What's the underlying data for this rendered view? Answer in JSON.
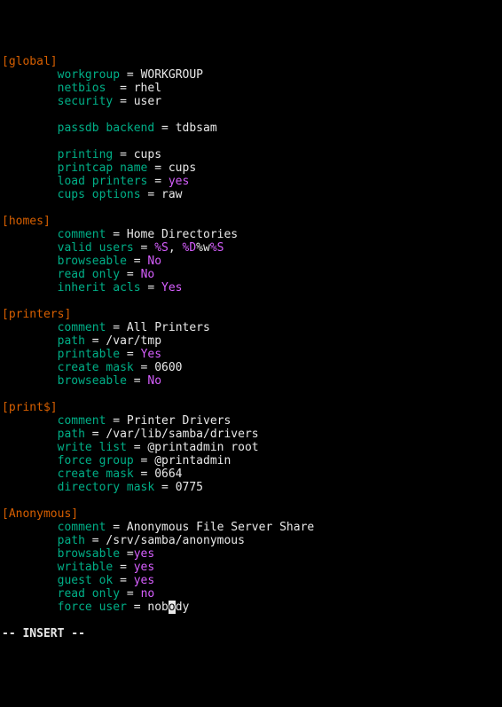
{
  "indent": "        ",
  "sections": {
    "global": {
      "header": "[global]",
      "items": [
        {
          "key": "workgroup",
          "eq": " = ",
          "val": "WORKGROUP"
        },
        {
          "key": "netbios",
          "eq": "  = ",
          "val": "rhel"
        },
        {
          "key": "security",
          "eq": " = ",
          "val": "user"
        },
        {
          "blank": true
        },
        {
          "key": "passdb backend",
          "eq": " = ",
          "val": "tdbsam"
        },
        {
          "blank": true
        },
        {
          "key": "printing",
          "eq": " = ",
          "val": "cups"
        },
        {
          "key": "printcap name",
          "eq": " = ",
          "val": "cups"
        },
        {
          "key": "load printers",
          "eq": " = ",
          "kw": "yes"
        },
        {
          "key": "cups options",
          "eq": " = ",
          "val": "raw"
        }
      ]
    },
    "homes": {
      "header": "[homes]",
      "items": [
        {
          "key": "comment",
          "eq": " = ",
          "val": "Home Directories"
        },
        {
          "key": "valid users",
          "eq": " = ",
          "tokens": [
            {
              "t": "%S",
              "c": "pnk"
            },
            {
              "t": ", ",
              "c": "val"
            },
            {
              "t": "%D",
              "c": "pnk"
            },
            {
              "t": "%w",
              "c": "val"
            },
            {
              "t": "%S",
              "c": "pnk"
            }
          ]
        },
        {
          "key": "browseable",
          "eq": " = ",
          "kw": "No"
        },
        {
          "key": "read only",
          "eq": " = ",
          "kw": "No"
        },
        {
          "key": "inherit acls",
          "eq": " = ",
          "kw": "Yes"
        }
      ]
    },
    "printers": {
      "header": "[printers]",
      "items": [
        {
          "key": "comment",
          "eq": " = ",
          "val": "All Printers"
        },
        {
          "key": "path",
          "eq": " = ",
          "val": "/var/tmp"
        },
        {
          "key": "printable",
          "eq": " = ",
          "kw": "Yes"
        },
        {
          "key": "create mask",
          "eq": " = ",
          "val": "0600"
        },
        {
          "key": "browseable",
          "eq": " = ",
          "kw": "No"
        }
      ]
    },
    "print_dollar": {
      "header": "[print$]",
      "items": [
        {
          "key": "comment",
          "eq": " = ",
          "val": "Printer Drivers"
        },
        {
          "key": "path",
          "eq": " = ",
          "val": "/var/lib/samba/drivers"
        },
        {
          "key": "write list",
          "eq": " = ",
          "val": "@printadmin root"
        },
        {
          "key": "force group",
          "eq": " = ",
          "val": "@printadmin"
        },
        {
          "key": "create mask",
          "eq": " = ",
          "val": "0664"
        },
        {
          "key": "directory mask",
          "eq": " = ",
          "val": "0775"
        }
      ]
    },
    "anonymous": {
      "header": "[Anonymous]",
      "items": [
        {
          "key": "comment",
          "eq": " = ",
          "val": "Anonymous File Server Share"
        },
        {
          "key": "path",
          "eq": " = ",
          "val": "/srv/samba/anonymous"
        },
        {
          "key": "browsable",
          "eq": " =",
          "kw": "yes"
        },
        {
          "key": "writable",
          "eq": " = ",
          "kw": "yes"
        },
        {
          "key": "guest ok",
          "eq": " = ",
          "kw": "yes"
        },
        {
          "key": "read only",
          "eq": " = ",
          "kw": "no"
        },
        {
          "key": "force user",
          "eq": " = ",
          "cursor_val": {
            "pre": "nob",
            "cur": "o",
            "post": "dy"
          }
        }
      ]
    }
  },
  "status_line": "-- INSERT --"
}
